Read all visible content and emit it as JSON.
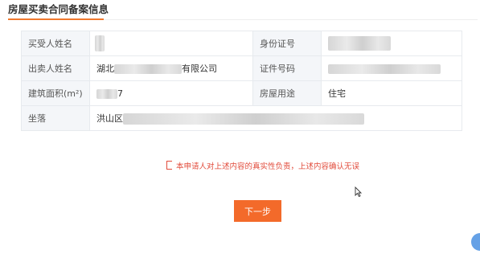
{
  "section": {
    "title": "房屋买卖合同备案信息"
  },
  "table": {
    "rows": [
      {
        "label1": "买受人姓名",
        "value1": "",
        "label2": "身份证号",
        "value2": ""
      },
      {
        "label1": "出卖人姓名",
        "value1_prefix": "湖北",
        "value1_suffix": "有限公司",
        "label2": "证件号码",
        "value2": ""
      },
      {
        "label1": "建筑面积(m²)",
        "value1_suffix": "7",
        "label2": "房屋用途",
        "value2": "住宅"
      },
      {
        "label1": "坐落",
        "value1_prefix": "洪山区"
      }
    ]
  },
  "confirm": {
    "text": "本申请人对上述内容的真实性负责，上述内容确认无误"
  },
  "buttons": {
    "next": "下一步"
  },
  "colors": {
    "accent": "#f36a2a",
    "warning": "#e24c3c",
    "label_bg": "#f4f6f9"
  }
}
